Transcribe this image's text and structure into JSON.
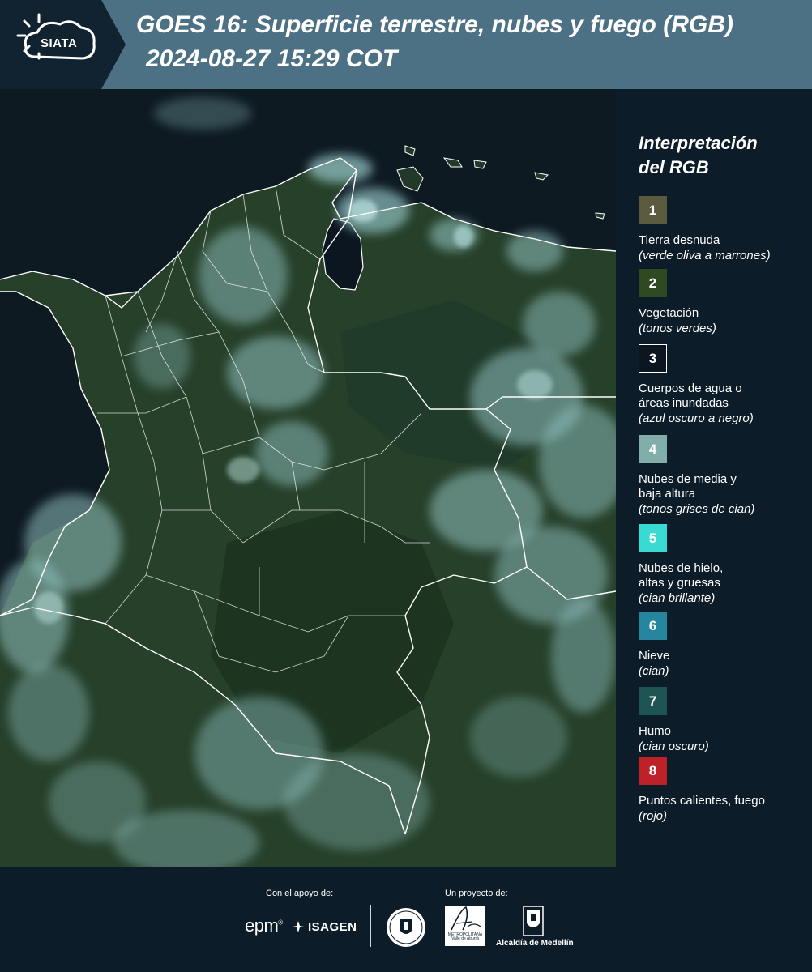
{
  "header": {
    "logo_text": "SIATA",
    "title": "GOES 16: Superficie terrestre, nubes y fuego (RGB)",
    "datetime": "2024-08-27 15:29 COT",
    "background_color": "#4d7184",
    "logo_panel_color": "#112230"
  },
  "legend": {
    "title_line1": "Interpretación",
    "title_line2": "del RGB",
    "items": [
      {
        "number": "1",
        "color": "#5b5a3f",
        "label": "Tierra desnuda",
        "note": "(verde oliva a marrones)"
      },
      {
        "number": "2",
        "color": "#2f4a22",
        "label": "Vegetación",
        "note": "(tonos verdes)"
      },
      {
        "number": "3",
        "color": "#0c1620",
        "label": "Cuerpos de agua o\náreas inundadas",
        "note": "(azul oscuro a negro)"
      },
      {
        "number": "4",
        "color": "#82aeaa",
        "label": "Nubes de media y\nbaja altura",
        "note": "(tonos grises de cian)"
      },
      {
        "number": "5",
        "color": "#39dad3",
        "label": "Nubes de hielo,\naltas y gruesas",
        "note": "(cian brillante)"
      },
      {
        "number": "6",
        "color": "#2686a0",
        "label": "Nieve",
        "note": "(cian)"
      },
      {
        "number": "7",
        "color": "#1e5453",
        "label": "Humo",
        "note": "(cian oscuro)"
      },
      {
        "number": "8",
        "color": "#be2127",
        "label": "Puntos calientes, fuego",
        "note": "(rojo)"
      }
    ]
  },
  "footer": {
    "support_label": "Con el apoyo de:",
    "project_label": "Un proyecto de:",
    "epm_logo": "epm",
    "isagen_logo": "ISAGEN",
    "area_logo": "METROPOLITANA Valle de Aburrá",
    "alcaldia_label": "Alcaldía de Medellín"
  },
  "map": {
    "ocean_color": "#0e1a22",
    "land_color": "#26402a",
    "cloud_color": "#8fbfc0",
    "border_color": "#ffffff"
  }
}
